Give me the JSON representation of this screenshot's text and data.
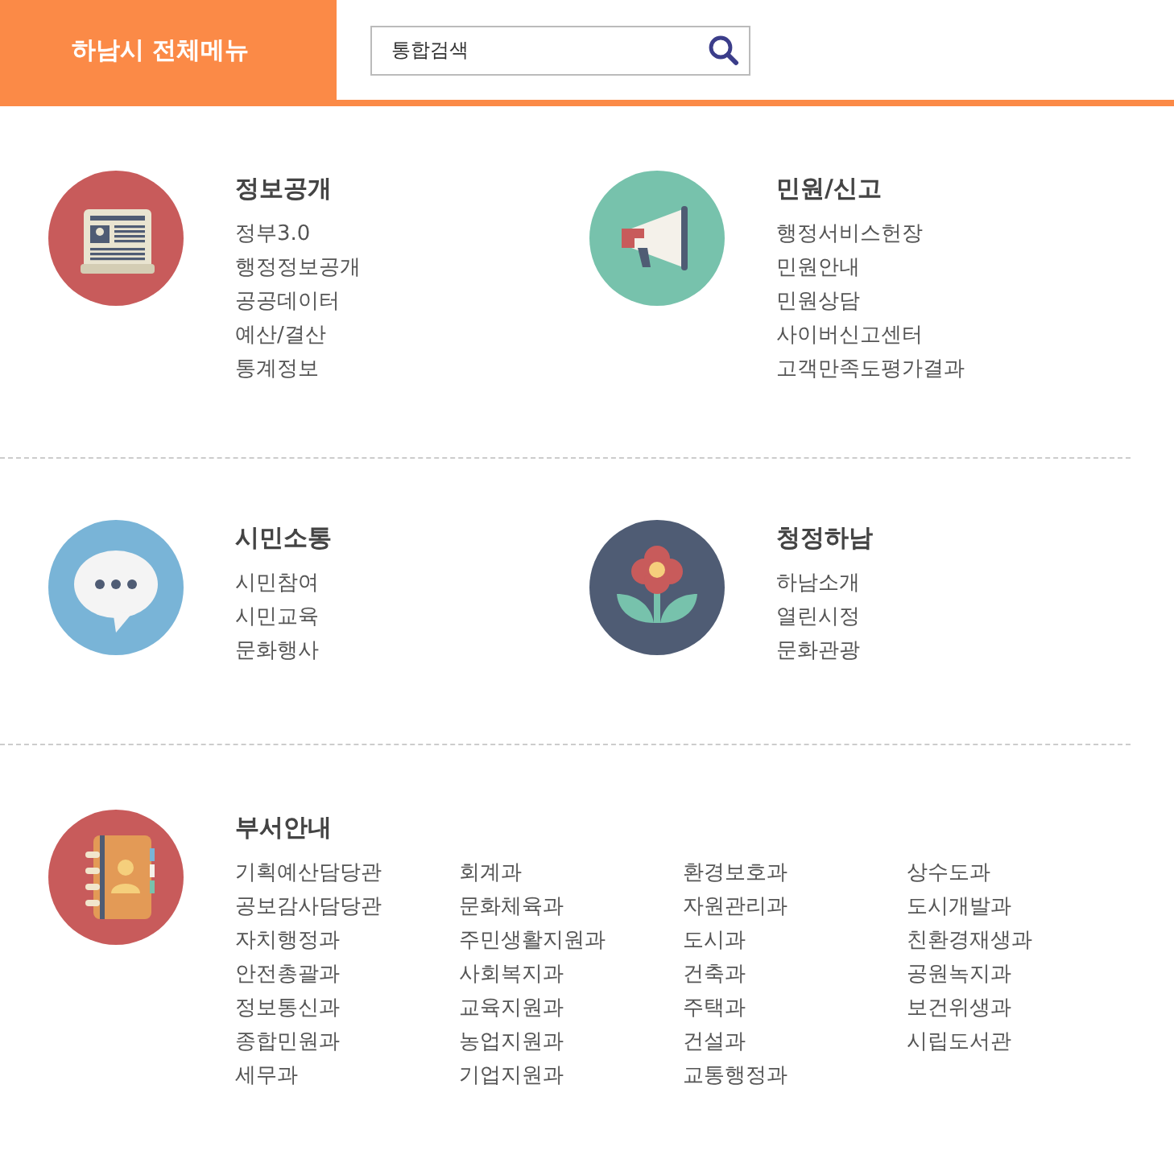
{
  "header": {
    "title": "하남시 전체메뉴",
    "search": {
      "value": "통합검색"
    }
  },
  "sections": [
    {
      "title": "정보공개",
      "kind": "newspaper",
      "color": "#c85b5b",
      "links": [
        "정부3.0",
        "행정정보공개",
        "공공데이터",
        "예산/결산",
        "통계정보"
      ]
    },
    {
      "title": "민원/신고",
      "kind": "megaphone",
      "color": "#77c2ac",
      "links": [
        "행정서비스헌장",
        "민원안내",
        "민원상담",
        "사이버신고센터",
        "고객만족도평가결과"
      ]
    },
    {
      "title": "시민소통",
      "kind": "chat",
      "color": "#79b4d7",
      "links": [
        "시민참여",
        "시민교육",
        "문화행사"
      ]
    },
    {
      "title": "청정하남",
      "kind": "flower",
      "color": "#4f5c74",
      "links": [
        "하남소개",
        "열린시정",
        "문화관광"
      ]
    }
  ],
  "departments": {
    "title": "부서안내",
    "kind": "addressbook",
    "color": "#c85b5b",
    "links": [
      "기획예산담당관",
      "공보감사담당관",
      "자치행정과",
      "안전총괄과",
      "정보통신과",
      "종합민원과",
      "세무과",
      "회계과",
      "문화체육과",
      "주민생활지원과",
      "사회복지과",
      "교육지원과",
      "농업지원과",
      "기업지원과",
      "환경보호과",
      "자원관리과",
      "도시과",
      "건축과",
      "주택과",
      "건설과",
      "교통행정과",
      "상수도과",
      "도시개발과",
      "친환경재생과",
      "공원녹지과",
      "보건위생과",
      "시립도서관"
    ]
  }
}
